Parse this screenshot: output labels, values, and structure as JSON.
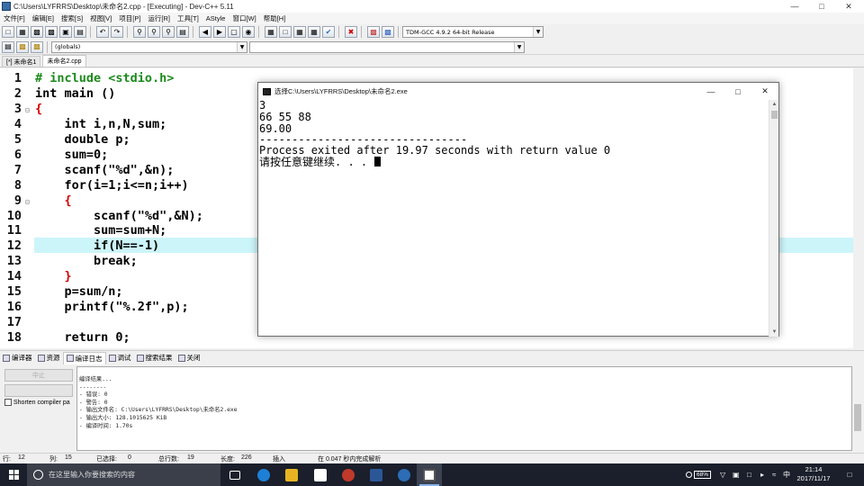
{
  "window": {
    "title": "C:\\Users\\LYFRRS\\Desktop\\未命名2.cpp - [Executing] - Dev-C++ 5.11"
  },
  "menu": [
    "文件[F]",
    "编辑[E]",
    "搜索[S]",
    "视图[V]",
    "项目[P]",
    "运行[R]",
    "工具[T]",
    "AStyle",
    "窗口[W]",
    "帮助[H]"
  ],
  "toolbar": {
    "compiler": "TDM-GCC 4.9.2 64-bit Release",
    "scope": "(globals)"
  },
  "tabs": [
    "[*] 未命名1",
    "未命名2.cpp"
  ],
  "editor": {
    "highlighted_line": 12,
    "lines": [
      {
        "n": "1",
        "text": "# include <stdio.h>"
      },
      {
        "n": "2",
        "text": "int main ()"
      },
      {
        "n": "3",
        "text": "{"
      },
      {
        "n": "4",
        "text": "    int i,n,N,sum;"
      },
      {
        "n": "5",
        "text": "    double p;"
      },
      {
        "n": "6",
        "text": "    sum=0;"
      },
      {
        "n": "7",
        "text": "    scanf(\"%d\",&n);"
      },
      {
        "n": "8",
        "text": "    for(i=1;i<=n;i++)"
      },
      {
        "n": "9",
        "text": "    {"
      },
      {
        "n": "10",
        "text": "        scanf(\"%d\",&N);"
      },
      {
        "n": "11",
        "text": "        sum=sum+N;"
      },
      {
        "n": "12",
        "text": "        if(N==-1)"
      },
      {
        "n": "13",
        "text": "        break;"
      },
      {
        "n": "14",
        "text": "    }"
      },
      {
        "n": "15",
        "text": "    p=sum/n;"
      },
      {
        "n": "16",
        "text": "    printf(\"%.2f\",p);"
      },
      {
        "n": "17",
        "text": ""
      },
      {
        "n": "18",
        "text": "    return 0;"
      }
    ]
  },
  "console": {
    "title": "选择C:\\Users\\LYFRRS\\Desktop\\未命名2.exe",
    "lines": [
      "3",
      "66 55 88",
      "69.00",
      "--------------------------------",
      "Process exited after 19.97 seconds with return value 0",
      "请按任意键继续. . . "
    ]
  },
  "bottom_tabs": [
    "编译器",
    "资源",
    "编译日志",
    "调试",
    "搜索结果",
    "关闭"
  ],
  "bottom_left": {
    "button1": "中止",
    "checkbox": "Shorten compiler pa"
  },
  "log": [
    "编译结果...",
    "--------",
    "- 错误: 0",
    "- 警告: 0",
    "- 输出文件名: C:\\Users\\LYFRRS\\Desktop\\未命名2.exe",
    "- 输出大小: 128.1015625 KiB",
    "- 编译时间: 1.70s"
  ],
  "status": {
    "line_label": "行:",
    "line_value": "12",
    "col_label": "列:",
    "col_value": "15",
    "sel_label": "已选择:",
    "sel_value": "0",
    "total_label": "总行数:",
    "total_value": "19",
    "len_label": "长度:",
    "len_value": "226",
    "mode": "插入",
    "parse": "在 0.047 秒内完成解析"
  },
  "taskbar": {
    "search_placeholder": "在这里输入你要搜索的内容",
    "battery": "68%",
    "ime": "中",
    "time": "21:14",
    "date": "2017/11/17"
  },
  "colors": {
    "highlight_line": "#ccf5f9",
    "keyword_red": "#d40000",
    "string_blue": "#0000d6",
    "preprocessor_green": "#1c8a1c",
    "taskbar": "#1a1f2b"
  }
}
